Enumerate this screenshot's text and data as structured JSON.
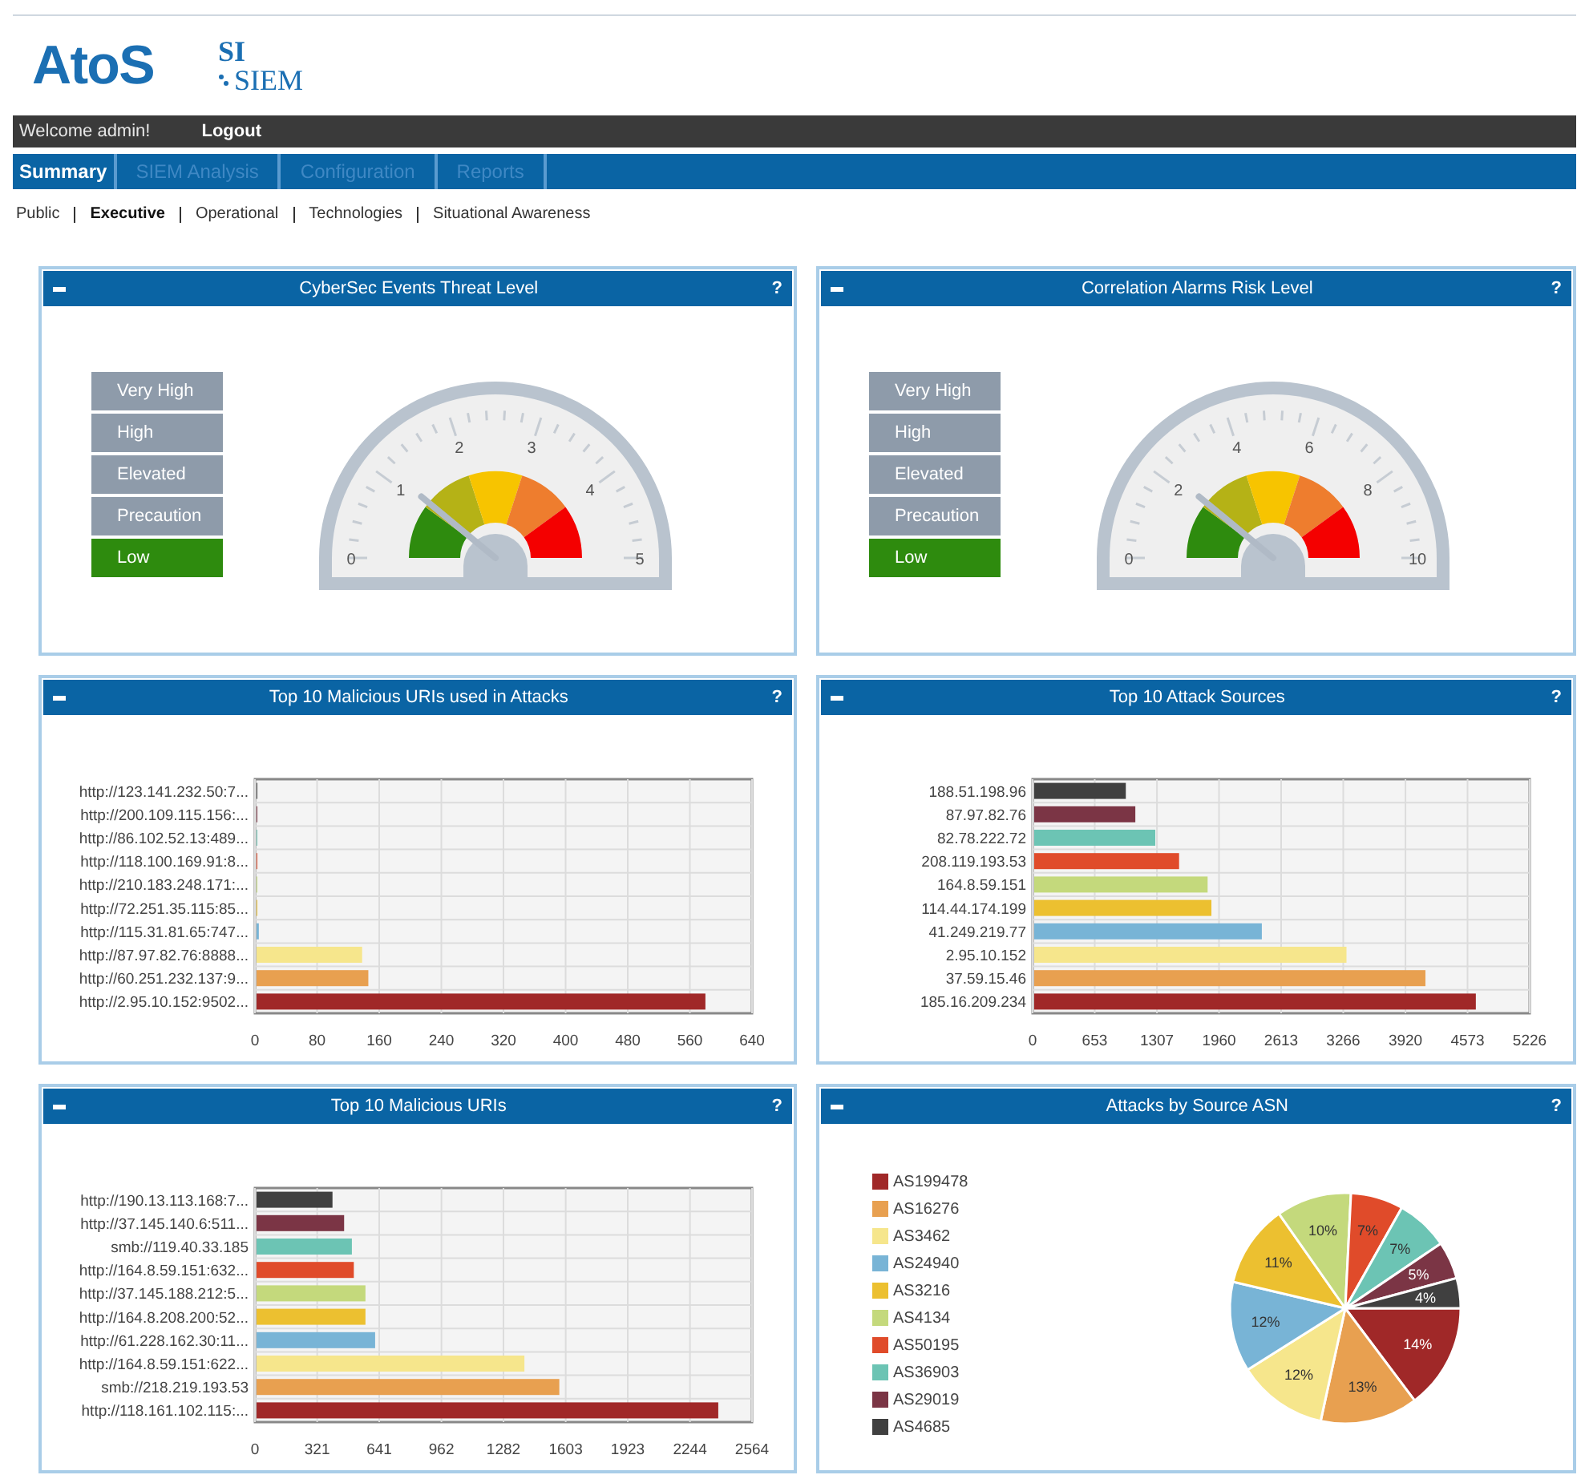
{
  "logo": {
    "brand": "AtoS",
    "product_top": "SI",
    "product": "SIEM"
  },
  "user_bar": {
    "welcome": "Welcome admin!",
    "logout": "Logout"
  },
  "tabs": [
    {
      "label": "Summary",
      "selected": true
    },
    {
      "label": "SIEM Analysis",
      "selected": false
    },
    {
      "label": "Configuration",
      "selected": false
    },
    {
      "label": "Reports",
      "selected": false
    }
  ],
  "subnav": [
    {
      "label": "Public",
      "selected": false
    },
    {
      "label": "Executive",
      "selected": true
    },
    {
      "label": "Operational",
      "selected": false
    },
    {
      "label": "Technologies",
      "selected": false
    },
    {
      "label": "Situational Awareness",
      "selected": false
    }
  ],
  "panels": [
    {
      "kind": "gauge",
      "title": "CyberSec Events Threat Level",
      "help": "?",
      "levels": [
        {
          "label": "Very High",
          "selected": false
        },
        {
          "label": "High",
          "selected": false
        },
        {
          "label": "Elevated",
          "selected": false
        },
        {
          "label": "Precaution",
          "selected": false
        },
        {
          "label": "Low",
          "selected": true
        }
      ],
      "scale_labels": [
        "0",
        "1",
        "2",
        "3",
        "4",
        "5"
      ]
    },
    {
      "kind": "gauge",
      "title": "Correlation Alarms Risk Level",
      "help": "?",
      "levels": [
        {
          "label": "Very High",
          "selected": false
        },
        {
          "label": "High",
          "selected": false
        },
        {
          "label": "Elevated",
          "selected": false
        },
        {
          "label": "Precaution",
          "selected": false
        },
        {
          "label": "Low",
          "selected": true
        }
      ],
      "scale_labels": [
        "0",
        "2",
        "4",
        "6",
        "8",
        "10"
      ]
    },
    {
      "kind": "bar",
      "title": "Top 10 Malicious URIs used in Attacks",
      "help": "?",
      "chart_data": {
        "type": "bar",
        "orientation": "horizontal",
        "categories": [
          "http://123.141.232.50:7...",
          "http://200.109.115.156:...",
          "http://86.102.52.13:489...",
          "http://118.100.169.91:8...",
          "http://210.183.248.171:...",
          "http://72.251.35.115:85...",
          "http://115.31.81.65:747...",
          "http://87.97.82.76:8888...",
          "http://60.251.232.137:9...",
          "http://2.95.10.152:9502..."
        ],
        "values": [
          0,
          0,
          0,
          1,
          0,
          3,
          5,
          138,
          146,
          580
        ],
        "colors": [
          "#404040",
          "#7b3545",
          "#6cc4b4",
          "#e04b2a",
          "#c4d97c",
          "#ecc030",
          "#78b4d6",
          "#f6e68c",
          "#e8a050",
          "#a02828"
        ],
        "xlim": [
          0,
          640
        ],
        "xticks": [
          0,
          80,
          160,
          240,
          320,
          400,
          480,
          560,
          640
        ],
        "grid": true
      }
    },
    {
      "kind": "bar",
      "title": "Top 10 Attack Sources",
      "help": "?",
      "chart_data": {
        "type": "bar",
        "orientation": "horizontal",
        "categories": [
          "188.51.198.96",
          "87.97.82.76",
          "82.78.222.72",
          "208.119.193.53",
          "164.8.59.151",
          "114.44.174.199",
          "41.249.219.77",
          "2.95.10.152",
          "37.59.15.46",
          "185.16.209.234"
        ],
        "values": [
          980,
          1080,
          1290,
          1540,
          1840,
          1880,
          2410,
          3300,
          4130,
          4660
        ],
        "colors": [
          "#404040",
          "#7b3545",
          "#6cc4b4",
          "#e04b2a",
          "#c4d97c",
          "#ecc030",
          "#78b4d6",
          "#f6e68c",
          "#e8a050",
          "#a02828"
        ],
        "xlim": [
          0,
          5226
        ],
        "xticks": [
          0,
          653,
          1307,
          1960,
          2613,
          3266,
          3920,
          4573,
          5226
        ],
        "grid": true
      }
    },
    {
      "kind": "bar",
      "title": "Top 10 Malicious URIs",
      "help": "?",
      "chart_data": {
        "type": "bar",
        "orientation": "horizontal",
        "categories": [
          "http://190.13.113.168:7...",
          "http://37.145.140.6:511...",
          "smb://119.40.33.185",
          "http://164.8.59.151:632...",
          "http://37.145.188.212:5...",
          "http://164.8.208.200:52...",
          "http://61.228.162.30:11...",
          "http://164.8.59.151:622...",
          "smb://218.219.193.53",
          "http://118.161.102.115:..."
        ],
        "values": [
          400,
          460,
          500,
          510,
          570,
          570,
          620,
          1390,
          1570,
          2390
        ],
        "colors": [
          "#404040",
          "#7b3545",
          "#6cc4b4",
          "#e04b2a",
          "#c4d97c",
          "#ecc030",
          "#78b4d6",
          "#f6e68c",
          "#e8a050",
          "#a02828"
        ],
        "xlim": [
          0,
          2564
        ],
        "xticks": [
          0,
          321,
          641,
          962,
          1282,
          1603,
          1923,
          2244,
          2564
        ],
        "grid": true
      }
    },
    {
      "kind": "pie",
      "title": "Attacks by Source ASN",
      "help": "?",
      "chart_data": {
        "type": "pie",
        "categories": [
          "AS199478",
          "AS16276",
          "AS3462",
          "AS24940",
          "AS3216",
          "AS4134",
          "AS50195",
          "AS36903",
          "AS29019",
          "AS4685"
        ],
        "values": [
          14,
          13,
          12,
          12,
          11,
          10,
          7,
          7,
          5,
          4
        ],
        "colors": [
          "#a02828",
          "#e8a050",
          "#f6e68c",
          "#78b4d6",
          "#ecc030",
          "#c4d97c",
          "#e04b2a",
          "#6cc4b4",
          "#7b3545",
          "#404040"
        ],
        "value_labels": [
          "14%",
          "13%",
          "12%",
          "12%",
          "11%",
          "10%",
          "7%",
          "7%",
          "5%",
          "4%"
        ]
      }
    }
  ]
}
